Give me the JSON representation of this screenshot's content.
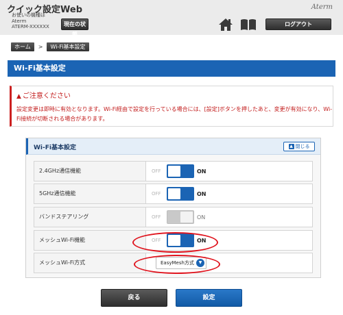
{
  "header": {
    "app_title": "クイック設定Web",
    "device_info_line1": "お使いの機種は",
    "device_info_line2": "Aterm",
    "device_info_line3": "ATERM-XXXXXX",
    "status_button": "現在の状態",
    "brand": "Aterm",
    "logout_button": "ログアウト",
    "home_icon": "home-icon",
    "manual_icon": "book-icon"
  },
  "breadcrumb": {
    "home": "ホーム",
    "separator": ">",
    "current": "Wi-Fi基本設定"
  },
  "page_title": "Wi-Fi基本設定",
  "notice": {
    "title": "ご注意ください",
    "text": "設定変更は即時に有効となります。Wi-Fi経由で設定を行っている場合には、[設定]ボタンを押したあと、変更が有効になり、Wi-Fi接続が切断される場合があります。"
  },
  "section": {
    "title": "Wi-Fi基本設定",
    "close_button": "閉じる",
    "rows": [
      {
        "label": "2.4GHz通信機能",
        "off": "OFF",
        "on": "ON",
        "state": "on"
      },
      {
        "label": "5GHz通信機能",
        "off": "OFF",
        "on": "ON",
        "state": "on"
      },
      {
        "label": "バンドステアリング",
        "off": "OFF",
        "on": "ON",
        "state": "disabled"
      },
      {
        "label": "メッシュWi-Fi機能",
        "off": "OFF",
        "on": "ON",
        "state": "on"
      },
      {
        "label": "メッシュWi-Fi方式",
        "select_value": "EasyMesh方式"
      }
    ]
  },
  "buttons": {
    "back": "戻る",
    "set": "設定"
  },
  "colors": {
    "accent": "#1b64b4",
    "warning": "#c21a1a",
    "annotation": "#e0141e"
  }
}
